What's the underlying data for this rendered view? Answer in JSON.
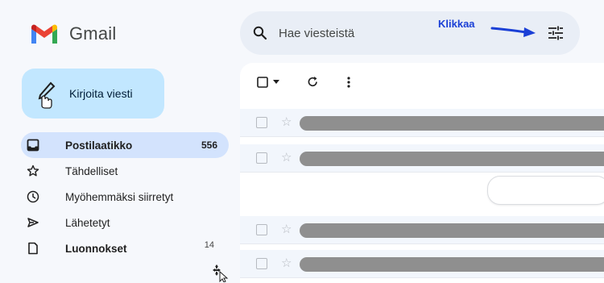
{
  "app": {
    "name": "Gmail"
  },
  "compose": {
    "label": "Kirjoita viesti"
  },
  "search": {
    "placeholder": "Hae viesteistä",
    "annotation": "Klikkaa"
  },
  "nav": {
    "items": [
      {
        "label": "Postilaatikko",
        "count": "556",
        "icon": "inbox-icon",
        "active": true
      },
      {
        "label": "Tähdelliset",
        "count": "",
        "icon": "star-icon"
      },
      {
        "label": "Myöhemmäksi siirretyt",
        "count": "",
        "icon": "clock-icon"
      },
      {
        "label": "Lähetetyt",
        "count": "",
        "icon": "send-icon"
      },
      {
        "label": "Luonnokset",
        "count": "14",
        "icon": "draft-icon"
      }
    ]
  },
  "colors": {
    "accent": "#c2e7ff",
    "active_nav": "#d3e3fd",
    "annotation": "#1a3fd6",
    "background": "#f6f8fc"
  },
  "icons": [
    "gmail-logo-icon",
    "pencil-icon",
    "hand-cursor-icon",
    "search-icon",
    "filter-options-icon",
    "select-checkbox-icon",
    "chevron-down-icon",
    "refresh-icon",
    "more-vert-icon",
    "move-cursor-icon"
  ]
}
